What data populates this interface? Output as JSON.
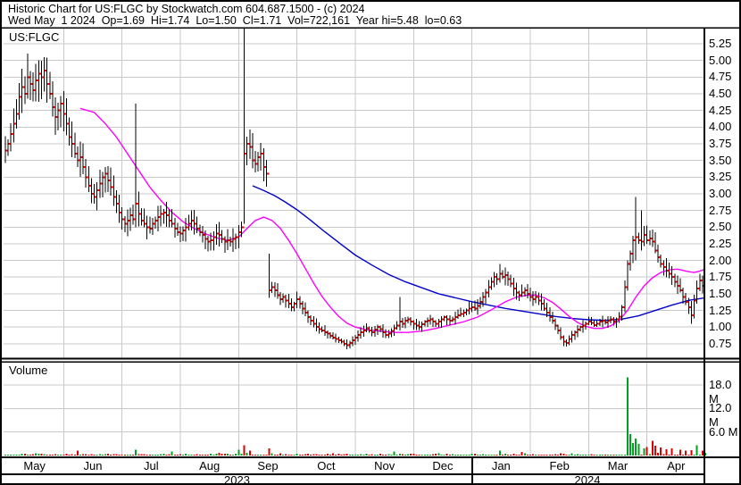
{
  "header": {
    "title_line": "Historic Chart for US:FLGC by Stockwatch.com 604.687.1500 - (c) 2024",
    "info_line": "Wed May  1 2024  Op=1.69  Hi=1.74  Lo=1.50  Cl=1.71  Vol=722,161  Year hi=5.48  lo=0.63"
  },
  "chart": {
    "symbol_label": "US:FLGC",
    "volume_label": "Volume"
  },
  "axes": {
    "price_ticks": [
      "5.25",
      "5.00",
      "4.75",
      "4.50",
      "4.25",
      "4.00",
      "3.75",
      "3.50",
      "3.25",
      "3.00",
      "2.75",
      "2.50",
      "2.25",
      "2.00",
      "1.75",
      "1.50",
      "1.25",
      "1.00",
      "0.75"
    ],
    "volume_ticks": [
      "18.0 M",
      "12.0 M",
      "6.0 M"
    ],
    "months": [
      "May",
      "Jun",
      "Jul",
      "Aug",
      "Sep",
      "Oct",
      "Nov",
      "Dec",
      "Jan",
      "Feb",
      "Mar",
      "Apr"
    ],
    "years": [
      "2023",
      "2024"
    ]
  },
  "colors": {
    "bg": "#ffffff",
    "border": "#000000",
    "grid": "#c8c8c8",
    "bar": "#000000",
    "close_tick": "#ff0000",
    "ma_fast": "#ff00ff",
    "ma_slow": "#0000cc",
    "volume_up": "#00a020",
    "volume_down": "#dd0000"
  },
  "chart_data": {
    "type": "ohlc+volume",
    "symbol": "US:FLGC",
    "title": "Historic Chart for US:FLGC",
    "x_axis": {
      "months": [
        "May",
        "Jun",
        "Jul",
        "Aug",
        "Sep",
        "Oct",
        "Nov",
        "Dec",
        "Jan",
        "Feb",
        "Mar",
        "Apr"
      ],
      "years": [
        "2023",
        "2024"
      ],
      "trading_days_total": 253,
      "days_per_month": 21
    },
    "price_axis": {
      "ticks": [
        5.25,
        5.0,
        4.75,
        4.5,
        4.25,
        4.0,
        3.75,
        3.5,
        3.25,
        3.0,
        2.75,
        2.5,
        2.25,
        2.0,
        1.75,
        1.5,
        1.25,
        1.0,
        0.75
      ],
      "range": [
        0.53,
        5.49
      ],
      "grid": true
    },
    "volume_axis": {
      "ticks_millions": [
        18,
        12,
        6
      ],
      "range_millions": [
        0,
        24
      ]
    },
    "latest_quote": {
      "date": "Wed May 1 2024",
      "open": 1.69,
      "high": 1.74,
      "low": 1.5,
      "close": 1.71,
      "volume": 722161,
      "year_high": 5.48,
      "year_low": 0.63
    },
    "daily_closes": [
      3.65,
      3.75,
      3.9,
      4.05,
      4.2,
      4.45,
      4.6,
      4.5,
      4.75,
      4.65,
      4.55,
      4.7,
      4.8,
      4.75,
      4.85,
      4.65,
      4.5,
      4.3,
      4.15,
      4.25,
      4.35,
      4.2,
      4.05,
      3.85,
      3.75,
      3.6,
      3.5,
      3.55,
      3.4,
      3.25,
      3.12,
      3.0,
      2.95,
      3.05,
      3.15,
      3.25,
      3.3,
      3.2,
      3.1,
      2.95,
      2.85,
      2.72,
      2.62,
      2.55,
      2.6,
      2.68,
      2.62,
      2.85,
      2.7,
      2.6,
      2.55,
      2.5,
      2.48,
      2.55,
      2.6,
      2.65,
      2.7,
      2.72,
      2.68,
      2.6,
      2.55,
      2.48,
      2.42,
      2.4,
      2.45,
      2.5,
      2.55,
      2.6,
      2.55,
      2.48,
      2.42,
      2.38,
      2.32,
      2.28,
      2.3,
      2.35,
      2.4,
      2.38,
      2.32,
      2.28,
      2.3,
      2.28,
      2.32,
      2.35,
      2.42,
      2.5,
      3.6,
      3.75,
      3.7,
      3.5,
      3.45,
      3.55,
      3.6,
      3.4,
      3.3,
      1.55,
      1.6,
      1.55,
      1.48,
      1.42,
      1.45,
      1.4,
      1.35,
      1.3,
      1.35,
      1.42,
      1.35,
      1.28,
      1.22,
      1.15,
      1.1,
      1.05,
      1.0,
      0.97,
      0.95,
      0.92,
      0.9,
      0.87,
      0.84,
      0.82,
      0.8,
      0.78,
      0.75,
      0.73,
      0.76,
      0.8,
      0.84,
      0.88,
      0.92,
      0.95,
      0.98,
      0.95,
      0.92,
      0.96,
      1.0,
      0.97,
      0.92,
      0.88,
      0.9,
      0.94,
      0.98,
      1.02,
      1.08,
      1.05,
      1.1,
      1.12,
      1.08,
      1.05,
      1.02,
      1.0,
      1.04,
      1.08,
      1.1,
      1.12,
      1.08,
      1.05,
      1.08,
      1.12,
      1.15,
      1.12,
      1.1,
      1.12,
      1.15,
      1.18,
      1.2,
      1.22,
      1.25,
      1.28,
      1.3,
      1.28,
      1.32,
      1.38,
      1.45,
      1.52,
      1.6,
      1.68,
      1.75,
      1.72,
      1.8,
      1.75,
      1.78,
      1.72,
      1.65,
      1.58,
      1.52,
      1.48,
      1.52,
      1.55,
      1.5,
      1.45,
      1.42,
      1.45,
      1.4,
      1.35,
      1.28,
      1.22,
      1.15,
      1.1,
      1.02,
      0.95,
      0.85,
      0.78,
      0.76,
      0.82,
      0.88,
      0.92,
      0.96,
      1.0,
      1.02,
      1.05,
      1.08,
      1.06,
      1.03,
      1.05,
      1.08,
      1.1,
      1.07,
      1.1,
      1.12,
      1.08,
      1.12,
      1.16,
      1.3,
      1.6,
      1.95,
      2.1,
      2.3,
      2.35,
      2.3,
      2.28,
      2.38,
      2.3,
      2.33,
      2.28,
      2.15,
      2.05,
      1.95,
      1.9,
      1.85,
      1.8,
      1.75,
      1.68,
      1.62,
      1.55,
      1.45,
      1.38,
      1.3,
      1.18,
      1.4,
      1.58,
      1.7,
      1.62,
      1.71
    ],
    "special_bars": [
      {
        "d": 8,
        "h": 5.1
      },
      {
        "d": 12,
        "h": 5.0
      },
      {
        "d": 14,
        "h": 5.05
      },
      {
        "d": 47,
        "h": 4.35,
        "l": 2.5
      },
      {
        "d": 86,
        "h": 5.48,
        "l": 2.55
      },
      {
        "d": 95,
        "h": 2.1,
        "l": 1.44
      },
      {
        "d": 142,
        "h": 1.45
      },
      {
        "d": 178,
        "h": 1.95
      },
      {
        "d": 227,
        "h": 2.95,
        "l": 2.0
      },
      {
        "d": 229,
        "h": 2.75
      },
      {
        "d": 247,
        "l": 1.05
      }
    ],
    "ma_fast_magenta": [
      [
        27,
        4.28
      ],
      [
        32,
        4.22
      ],
      [
        36,
        4.05
      ],
      [
        40,
        3.85
      ],
      [
        44,
        3.6
      ],
      [
        48,
        3.35
      ],
      [
        52,
        3.1
      ],
      [
        56,
        2.9
      ],
      [
        60,
        2.72
      ],
      [
        64,
        2.58
      ],
      [
        68,
        2.48
      ],
      [
        72,
        2.4
      ],
      [
        76,
        2.34
      ],
      [
        80,
        2.3
      ],
      [
        84,
        2.35
      ],
      [
        87,
        2.48
      ],
      [
        90,
        2.6
      ],
      [
        93,
        2.65
      ],
      [
        96,
        2.6
      ],
      [
        99,
        2.48
      ],
      [
        102,
        2.3
      ],
      [
        105,
        2.1
      ],
      [
        108,
        1.88
      ],
      [
        111,
        1.66
      ],
      [
        114,
        1.46
      ],
      [
        117,
        1.3
      ],
      [
        120,
        1.16
      ],
      [
        123,
        1.06
      ],
      [
        126,
        1.0
      ],
      [
        130,
        0.96
      ],
      [
        135,
        0.94
      ],
      [
        140,
        0.92
      ],
      [
        145,
        0.92
      ],
      [
        150,
        0.94
      ],
      [
        155,
        0.98
      ],
      [
        160,
        1.03
      ],
      [
        165,
        1.08
      ],
      [
        170,
        1.15
      ],
      [
        175,
        1.26
      ],
      [
        180,
        1.38
      ],
      [
        184,
        1.45
      ],
      [
        188,
        1.48
      ],
      [
        191,
        1.48
      ],
      [
        194,
        1.44
      ],
      [
        197,
        1.37
      ],
      [
        200,
        1.27
      ],
      [
        203,
        1.16
      ],
      [
        206,
        1.07
      ],
      [
        209,
        1.01
      ],
      [
        212,
        0.98
      ],
      [
        215,
        0.98
      ],
      [
        218,
        1.02
      ],
      [
        221,
        1.1
      ],
      [
        224,
        1.25
      ],
      [
        227,
        1.45
      ],
      [
        230,
        1.62
      ],
      [
        233,
        1.74
      ],
      [
        236,
        1.82
      ],
      [
        239,
        1.86
      ],
      [
        242,
        1.87
      ],
      [
        245,
        1.84
      ],
      [
        248,
        1.82
      ],
      [
        250,
        1.84
      ],
      [
        252,
        1.87
      ]
    ],
    "ma_slow_blue": [
      [
        89,
        3.12
      ],
      [
        93,
        3.05
      ],
      [
        97,
        2.97
      ],
      [
        101,
        2.87
      ],
      [
        105,
        2.76
      ],
      [
        110,
        2.6
      ],
      [
        115,
        2.43
      ],
      [
        120,
        2.27
      ],
      [
        126,
        2.08
      ],
      [
        132,
        1.93
      ],
      [
        138,
        1.79
      ],
      [
        144,
        1.68
      ],
      [
        150,
        1.59
      ],
      [
        156,
        1.5
      ],
      [
        162,
        1.44
      ],
      [
        168,
        1.38
      ],
      [
        174,
        1.33
      ],
      [
        180,
        1.28
      ],
      [
        186,
        1.24
      ],
      [
        192,
        1.2
      ],
      [
        198,
        1.16
      ],
      [
        204,
        1.13
      ],
      [
        210,
        1.11
      ],
      [
        216,
        1.1
      ],
      [
        222,
        1.12
      ],
      [
        228,
        1.17
      ],
      [
        234,
        1.25
      ],
      [
        240,
        1.33
      ],
      [
        246,
        1.4
      ],
      [
        252,
        1.44
      ]
    ],
    "volume_spikes_millions": [
      [
        26,
        1.3,
        "down"
      ],
      [
        47,
        1.5,
        "up"
      ],
      [
        60,
        1.0,
        "up"
      ],
      [
        84,
        1.5,
        "up"
      ],
      [
        86,
        2.6,
        "down"
      ],
      [
        88,
        1.2,
        "down"
      ],
      [
        95,
        1.8,
        "down"
      ],
      [
        140,
        1.0,
        "up"
      ],
      [
        178,
        1.2,
        "up"
      ],
      [
        186,
        0.9,
        "down"
      ],
      [
        224,
        20.0,
        "up"
      ],
      [
        225,
        5.5,
        "up"
      ],
      [
        226,
        3.2,
        "up"
      ],
      [
        227,
        4.3,
        "up"
      ],
      [
        228,
        3.0,
        "up"
      ],
      [
        230,
        1.8,
        "up"
      ],
      [
        231,
        2.2,
        "down"
      ],
      [
        233,
        3.8,
        "down"
      ],
      [
        234,
        2.5,
        "down"
      ],
      [
        236,
        2.0,
        "down"
      ],
      [
        238,
        1.6,
        "down"
      ],
      [
        240,
        1.8,
        "down"
      ],
      [
        243,
        1.5,
        "down"
      ],
      [
        245,
        1.2,
        "down"
      ],
      [
        247,
        1.4,
        "down"
      ],
      [
        249,
        2.6,
        "up"
      ],
      [
        251,
        1.2,
        "down"
      ],
      [
        252,
        0.72,
        "up"
      ]
    ]
  }
}
